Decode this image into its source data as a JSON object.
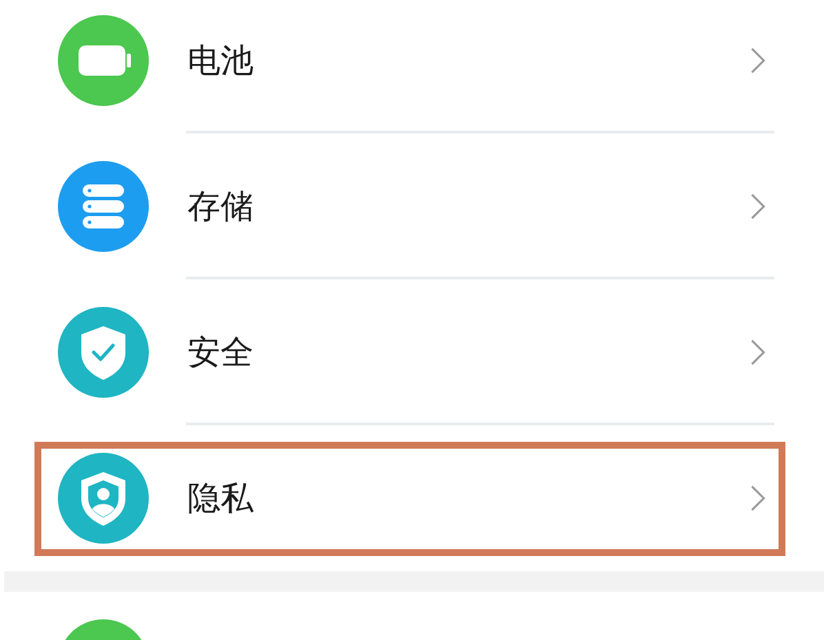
{
  "sections": [
    {
      "items": [
        {
          "kind": "battery",
          "label": "电池",
          "highlighted": false
        },
        {
          "kind": "storage",
          "label": "存储",
          "highlighted": false
        },
        {
          "kind": "security",
          "label": "安全",
          "highlighted": false
        },
        {
          "kind": "privacy",
          "label": "隐私",
          "highlighted": true
        }
      ]
    },
    {
      "items": [
        {
          "kind": "plain"
        }
      ]
    }
  ]
}
